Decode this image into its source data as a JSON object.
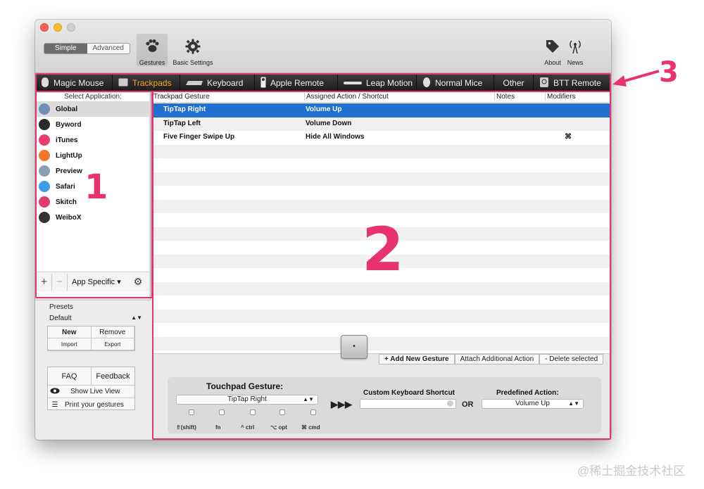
{
  "toolbar": {
    "mode_simple": "Simple",
    "mode_advanced": "Advanced",
    "gestures_label": "Gestures",
    "basic_settings_label": "Basic Settings",
    "about_label": "About",
    "news_label": "News"
  },
  "tabs": [
    {
      "label": "Magic Mouse"
    },
    {
      "label": "Trackpads"
    },
    {
      "label": "Keyboard"
    },
    {
      "label": "Apple Remote"
    },
    {
      "label": "Leap Motion"
    },
    {
      "label": "Normal Mice"
    },
    {
      "label": "Other"
    },
    {
      "label": "BTT Remote"
    }
  ],
  "sidebar": {
    "header": "Select Application:",
    "apps": [
      {
        "label": "Global",
        "color": "#6f8fb8"
      },
      {
        "label": "Byword",
        "color": "#2a2a2a"
      },
      {
        "label": "iTunes",
        "color": "#ea3e6a"
      },
      {
        "label": "LightUp",
        "color": "#f2762a"
      },
      {
        "label": "Preview",
        "color": "#8a9fb2"
      },
      {
        "label": "Safari",
        "color": "#3d9be9"
      },
      {
        "label": "Skitch",
        "color": "#e23c6b"
      },
      {
        "label": "WeiboX",
        "color": "#333333"
      }
    ],
    "plus": "+",
    "minus": "−",
    "app_specific": "App Specific",
    "gear": "⚙"
  },
  "presets": {
    "title": "Presets",
    "selected": "Default",
    "new": "New",
    "remove": "Remove",
    "import": "Import",
    "export": "Export",
    "faq": "FAQ",
    "feedback": "Feedback",
    "live_view": "Show Live View",
    "print": "Print your gestures"
  },
  "table": {
    "col_gesture": "Trackpad Gesture",
    "col_action": "Assigned Action / Shortcut",
    "col_notes": "Notes",
    "col_modifiers": "Modifiers",
    "rows": [
      {
        "gesture": "TipTap Right",
        "action": "Volume Up",
        "modifiers": ""
      },
      {
        "gesture": "TipTap Left",
        "action": "Volume Down",
        "modifiers": ""
      },
      {
        "gesture": "Five Finger Swipe Up",
        "action": "Hide All Windows",
        "modifiers": "⌘"
      }
    ]
  },
  "actions": {
    "add": "+ Add New Gesture",
    "attach": "Attach Additional Action",
    "delete": "- Delete selected"
  },
  "editor": {
    "touchpad_title": "Touchpad Gesture:",
    "touchpad_value": "TipTap Right",
    "arrows": "▶▶▶",
    "shortcut_title": "Custom Keyboard Shortcut",
    "or": "OR",
    "predefined_title": "Predefined Action:",
    "predefined_value": "Volume Up",
    "mods": [
      "⇧(shift)",
      "fn",
      "^ ctrl",
      "⌥ opt",
      "⌘ cmd"
    ]
  },
  "annotations": {
    "n1": "1",
    "n2": "2",
    "n3": "3"
  },
  "watermark": "@稀土掘金技术社区"
}
